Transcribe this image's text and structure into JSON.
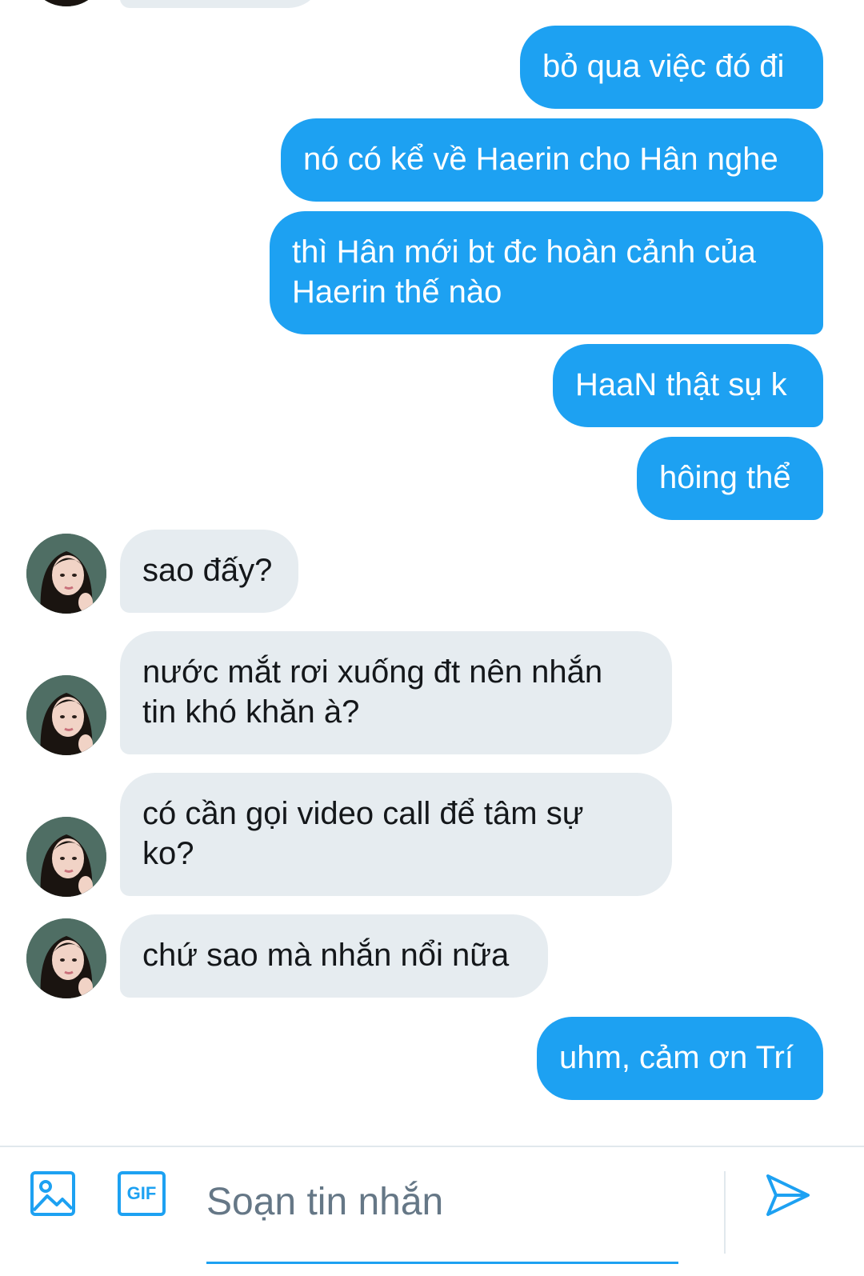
{
  "conversation": {
    "messages": [
      {
        "id": "m0",
        "direction": "in",
        "text": ""
      },
      {
        "id": "m1",
        "direction": "out",
        "text": "bỏ qua việc đó đi"
      },
      {
        "id": "m2",
        "direction": "out",
        "text": "nó có kể về Haerin cho Hân nghe"
      },
      {
        "id": "m3",
        "direction": "out",
        "text": "thì Hân mới bt đc hoàn cảnh của\nHaerin thế nào"
      },
      {
        "id": "m4",
        "direction": "out",
        "text": "HaaN thật sụ k"
      },
      {
        "id": "m5",
        "direction": "out",
        "text": "hôing thể"
      },
      {
        "id": "m6",
        "direction": "in",
        "text": "sao đấy?"
      },
      {
        "id": "m7",
        "direction": "in",
        "text": "nước mắt rơi xuống đt nên nhắn\ntin khó khăn à?"
      },
      {
        "id": "m8",
        "direction": "in",
        "text": "có cần gọi video call để tâm sự\nko?"
      },
      {
        "id": "m9",
        "direction": "in",
        "text": "chứ sao mà nhắn nổi nữa"
      },
      {
        "id": "m10",
        "direction": "out",
        "text": "uhm, cảm ơn Trí"
      }
    ]
  },
  "composer": {
    "placeholder": "Soạn tin nhắn",
    "value": "",
    "gif_label": "GIF",
    "image_icon": "image-icon",
    "send_icon": "send-icon"
  },
  "colors": {
    "accent": "#1da1f2",
    "incoming_bubble": "#e6ecf0",
    "text_dark": "#14171a",
    "placeholder": "#657786"
  }
}
